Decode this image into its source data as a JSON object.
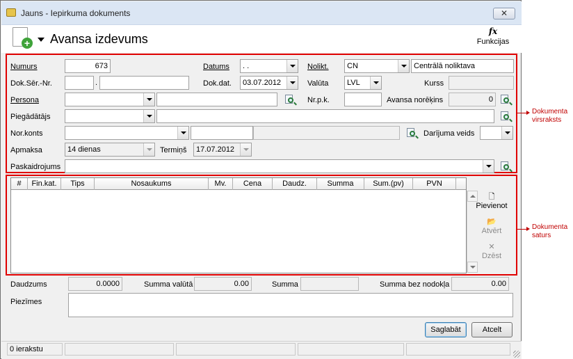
{
  "window": {
    "title": "Jauns - Iepirkuma dokuments",
    "close_glyph": "✕"
  },
  "header": {
    "doc_title": "Avansa izdevums",
    "functions_label": "Funkcijas",
    "functions_symbol": "fx"
  },
  "form": {
    "numurs": {
      "label": "Numurs",
      "value": "673"
    },
    "datums": {
      "label": "Datums",
      "value": " .  ."
    },
    "noliktava": {
      "label": "Nolikt.",
      "code": "CN",
      "name": "Centrālā noliktava"
    },
    "dok_ser_nr": {
      "label": "Dok.Sēr.-Nr.",
      "series": "",
      "separator": ".",
      "number": ""
    },
    "dok_dat": {
      "label": "Dok.dat.",
      "value": "03.07.2012"
    },
    "valuta": {
      "label": "Valūta",
      "value": "LVL"
    },
    "kurss": {
      "label": "Kurss",
      "value": ""
    },
    "persona": {
      "label": "Persona",
      "value": "",
      "name": ""
    },
    "nr_pk": {
      "label": "Nr.p.k.",
      "value": ""
    },
    "avansa_norekins": {
      "label": "Avansa norēķins",
      "value": "0"
    },
    "piegadatajs": {
      "label": "Piegādātājs",
      "value": "",
      "name": ""
    },
    "nor_konts": {
      "label": "Nor.konts",
      "value": "",
      "account": "",
      "bank": ""
    },
    "darijuma_veids": {
      "label": "Darījuma veids",
      "value": ""
    },
    "apmaksa": {
      "label": "Apmaksa",
      "value": "14 dienas"
    },
    "termins": {
      "label": "Termiņš",
      "value": "17.07.2012"
    },
    "paskaidrojums": {
      "label": "Paskaidrojums",
      "value": ""
    }
  },
  "annotations": {
    "header_note": [
      "Dokumenta",
      "virsraksts"
    ],
    "content_note": [
      "Dokumenta",
      "saturs"
    ]
  },
  "grid": {
    "columns": [
      "#",
      "Fin.kat.",
      "Tips",
      "Nosaukums",
      "Mv.",
      "Cena",
      "Daudz.",
      "Summa",
      "Sum.(pv)",
      "PVN"
    ],
    "rows": []
  },
  "grid_actions": {
    "add": {
      "label": "Pievienot",
      "icon": "new-document-icon",
      "glyph": "🗋"
    },
    "open": {
      "label": "Atvērt",
      "icon": "open-folder-icon",
      "glyph": "📂"
    },
    "delete": {
      "label": "Dzēst",
      "icon": "delete-x-icon",
      "glyph": "✕"
    }
  },
  "totals": {
    "daudzums": {
      "label": "Daudzums",
      "value": "0.0000"
    },
    "summa_valuta": {
      "label": "Summa valūtā",
      "value": "0.00"
    },
    "summa": {
      "label": "Summa",
      "value": ""
    },
    "summa_bez_nodokla": {
      "label": "Summa bez nodokļa",
      "value": "0.00"
    }
  },
  "piezimes": {
    "label": "Piezīmes",
    "value": ""
  },
  "buttons": {
    "save": "Saglabāt",
    "cancel": "Atcelt"
  },
  "status": {
    "records": "0 ierakstu"
  },
  "colors": {
    "annotation": "#e00000",
    "titlebar": "#dbe6f4",
    "window": "#f0f0f0"
  }
}
